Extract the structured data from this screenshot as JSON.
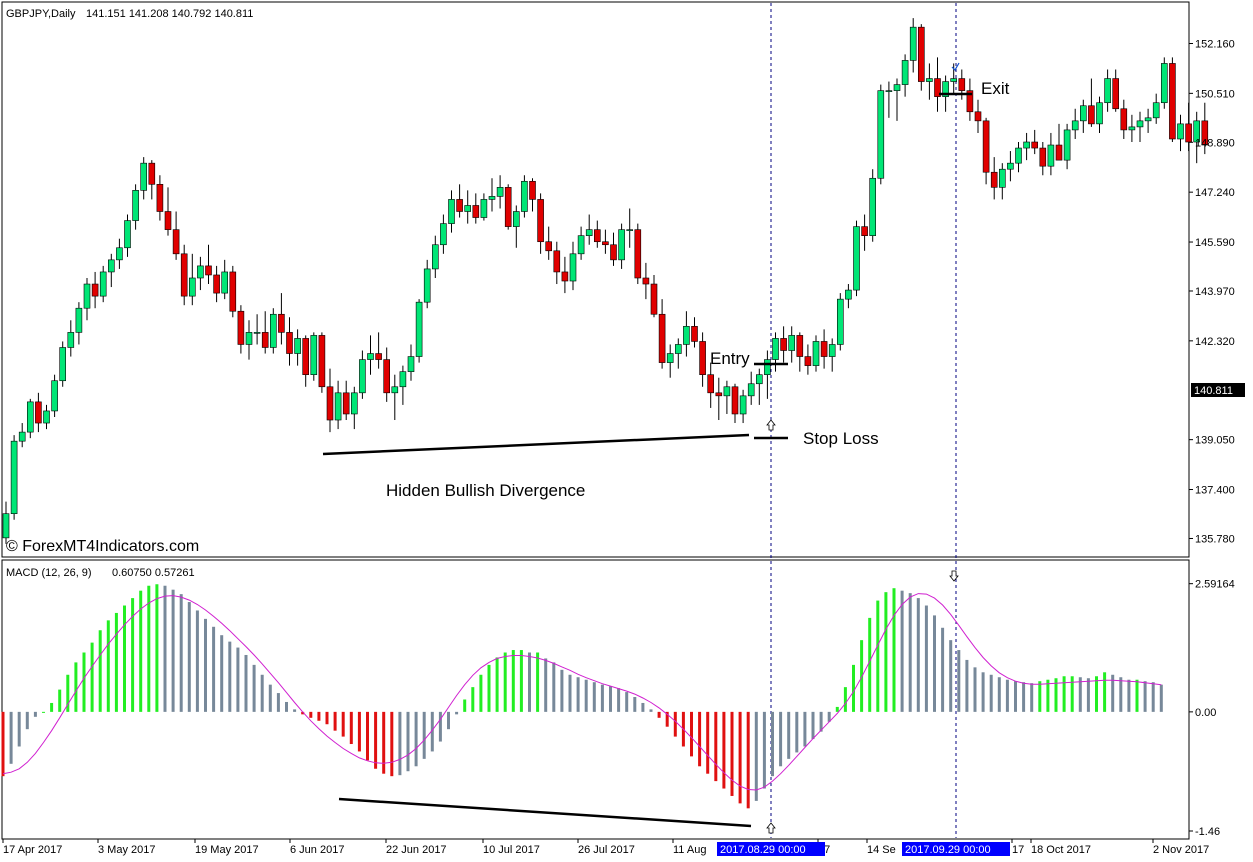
{
  "header": {
    "symbol": "GBPJPY,Daily",
    "ohlc": "141.151 141.208 140.792 140.811",
    "watermark": "© ForexMT4Indicators.com"
  },
  "annotations": {
    "entry": "Entry",
    "stop_loss": "Stop Loss",
    "exit": "Exit",
    "divergence": "Hidden Bullish Divergence"
  },
  "indicator": {
    "title": "MACD (12, 26, 9)",
    "values": "0.60750 0.57261"
  },
  "price_axis": {
    "ticks": [
      "152.160",
      "150.510",
      "148.890",
      "147.240",
      "145.590",
      "143.970",
      "142.320",
      "139.050",
      "137.400",
      "135.780"
    ],
    "current_price": "140.811"
  },
  "macd_axis": {
    "ticks": [
      "2.59164",
      "0.00",
      "-1.46"
    ]
  },
  "time_axis": {
    "labels": [
      "17 Apr 2017",
      "3 May 2017",
      "19 May 2017",
      "6 Jun 2017",
      "22 Jun 2017",
      "10 Jul 2017",
      "26 Jul 2017",
      "11 Aug",
      "17",
      "14 Se",
      "17",
      "18 Oct 2017",
      "2 Nov 2017"
    ],
    "highlight_1": "2017.08.29 00:00",
    "highlight_2": "2017.09.29 00:00"
  },
  "colors": {
    "bull": "#00e676",
    "bear": "#e00000",
    "macd_up": "#22ee22",
    "macd_down_neg": "#e01010",
    "macd_other": "#778899",
    "signal": "#d020d0",
    "highlight": "#0000ff"
  },
  "chart_data": {
    "type": "candlestick",
    "price_ylim": [
      135.2,
      153.5
    ],
    "candles": [
      [
        135.8,
        137.0,
        135.6,
        136.6
      ],
      [
        136.6,
        139.2,
        136.4,
        139.0
      ],
      [
        139.0,
        139.6,
        138.8,
        139.3
      ],
      [
        139.3,
        140.4,
        139.1,
        140.3
      ],
      [
        140.3,
        140.6,
        139.3,
        139.6
      ],
      [
        139.6,
        140.2,
        139.4,
        140.0
      ],
      [
        140.0,
        141.2,
        139.8,
        141.0
      ],
      [
        141.0,
        142.3,
        140.8,
        142.1
      ],
      [
        142.1,
        143.0,
        141.8,
        142.6
      ],
      [
        142.6,
        143.6,
        142.2,
        143.4
      ],
      [
        143.4,
        144.4,
        143.0,
        144.2
      ],
      [
        144.2,
        144.6,
        143.4,
        143.8
      ],
      [
        143.8,
        144.8,
        143.6,
        144.6
      ],
      [
        144.6,
        145.2,
        144.1,
        145.0
      ],
      [
        145.0,
        145.7,
        144.7,
        145.4
      ],
      [
        145.4,
        146.5,
        145.1,
        146.3
      ],
      [
        146.3,
        147.5,
        146.0,
        147.3
      ],
      [
        147.3,
        148.4,
        147.0,
        148.2
      ],
      [
        148.2,
        148.3,
        147.0,
        147.5
      ],
      [
        147.5,
        147.8,
        146.3,
        146.6
      ],
      [
        146.6,
        147.4,
        145.8,
        146.0
      ],
      [
        146.0,
        146.6,
        145.0,
        145.2
      ],
      [
        145.2,
        145.5,
        143.5,
        143.8
      ],
      [
        143.8,
        145.2,
        143.5,
        144.4
      ],
      [
        144.4,
        145.1,
        144.0,
        144.8
      ],
      [
        144.8,
        145.5,
        144.2,
        144.5
      ],
      [
        144.5,
        144.8,
        143.6,
        143.9
      ],
      [
        143.9,
        145.0,
        143.7,
        144.6
      ],
      [
        144.6,
        144.8,
        143.1,
        143.3
      ],
      [
        143.3,
        143.5,
        141.9,
        142.2
      ],
      [
        142.2,
        143.0,
        141.7,
        142.6
      ],
      [
        142.6,
        143.2,
        142.2,
        142.6
      ],
      [
        142.6,
        143.3,
        141.9,
        142.1
      ],
      [
        142.1,
        143.4,
        141.9,
        143.2
      ],
      [
        143.2,
        143.9,
        142.2,
        142.6
      ],
      [
        142.6,
        143.1,
        141.5,
        141.9
      ],
      [
        141.9,
        142.7,
        141.5,
        142.4
      ],
      [
        142.4,
        142.5,
        140.8,
        141.2
      ],
      [
        141.2,
        142.6,
        141.0,
        142.5
      ],
      [
        142.5,
        142.6,
        140.6,
        140.8
      ],
      [
        140.8,
        141.4,
        139.3,
        139.7
      ],
      [
        139.7,
        141.0,
        139.4,
        140.6
      ],
      [
        140.6,
        141.0,
        139.7,
        139.9
      ],
      [
        139.9,
        140.8,
        139.4,
        140.6
      ],
      [
        140.6,
        142.0,
        140.4,
        141.7
      ],
      [
        141.7,
        142.5,
        141.2,
        141.9
      ],
      [
        141.9,
        142.6,
        141.4,
        141.7
      ],
      [
        141.7,
        142.1,
        140.3,
        140.6
      ],
      [
        140.6,
        141.2,
        139.7,
        140.8
      ],
      [
        140.8,
        141.5,
        140.2,
        141.3
      ],
      [
        141.3,
        142.2,
        141.0,
        141.8
      ],
      [
        141.8,
        143.7,
        141.6,
        143.6
      ],
      [
        143.6,
        145.0,
        143.4,
        144.7
      ],
      [
        144.7,
        145.8,
        144.4,
        145.5
      ],
      [
        145.5,
        146.5,
        145.2,
        146.2
      ],
      [
        146.2,
        147.3,
        145.9,
        147.0
      ],
      [
        147.0,
        147.5,
        146.4,
        146.6
      ],
      [
        146.6,
        147.3,
        146.2,
        146.8
      ],
      [
        146.8,
        147.2,
        146.2,
        146.4
      ],
      [
        146.4,
        147.2,
        146.3,
        147.0
      ],
      [
        147.0,
        147.7,
        146.6,
        147.1
      ],
      [
        147.1,
        147.8,
        146.7,
        147.4
      ],
      [
        147.4,
        147.5,
        146.0,
        146.1
      ],
      [
        146.1,
        146.8,
        145.4,
        146.6
      ],
      [
        146.6,
        147.8,
        146.4,
        147.6
      ],
      [
        147.6,
        147.7,
        146.6,
        147.0
      ],
      [
        147.0,
        147.2,
        145.2,
        145.6
      ],
      [
        145.6,
        146.1,
        145.0,
        145.3
      ],
      [
        145.3,
        145.6,
        144.2,
        144.6
      ],
      [
        144.6,
        145.1,
        143.9,
        144.3
      ],
      [
        144.3,
        145.6,
        144.0,
        145.2
      ],
      [
        145.2,
        146.1,
        145.0,
        145.8
      ],
      [
        145.8,
        146.5,
        145.5,
        146.0
      ],
      [
        146.0,
        146.3,
        145.4,
        145.6
      ],
      [
        145.6,
        146.0,
        145.2,
        145.5
      ],
      [
        145.5,
        145.9,
        144.8,
        145.0
      ],
      [
        145.0,
        146.2,
        144.7,
        146.0
      ],
      [
        146.0,
        146.7,
        145.4,
        146.0
      ],
      [
        146.0,
        146.2,
        144.2,
        144.4
      ],
      [
        144.4,
        144.9,
        143.7,
        144.2
      ],
      [
        144.2,
        144.5,
        143.1,
        143.2
      ],
      [
        143.2,
        143.7,
        141.4,
        141.6
      ],
      [
        141.6,
        142.2,
        141.1,
        141.9
      ],
      [
        141.9,
        142.4,
        141.4,
        142.2
      ],
      [
        142.2,
        143.3,
        141.8,
        142.8
      ],
      [
        142.8,
        143.1,
        142.1,
        142.3
      ],
      [
        142.3,
        142.6,
        140.8,
        141.2
      ],
      [
        141.2,
        141.6,
        140.1,
        140.6
      ],
      [
        140.6,
        141.1,
        139.7,
        140.5
      ],
      [
        140.5,
        141.0,
        139.9,
        140.8
      ],
      [
        140.8,
        140.9,
        139.6,
        139.9
      ],
      [
        139.9,
        140.7,
        139.6,
        140.5
      ],
      [
        140.5,
        141.3,
        140.2,
        140.9
      ],
      [
        140.9,
        141.4,
        140.2,
        141.2
      ],
      [
        141.2,
        142.0,
        140.4,
        141.7
      ],
      [
        141.7,
        142.6,
        141.3,
        142.4
      ],
      [
        142.4,
        142.8,
        141.6,
        142.0
      ],
      [
        142.0,
        142.8,
        141.6,
        142.5
      ],
      [
        142.5,
        142.6,
        141.3,
        141.8
      ],
      [
        141.8,
        142.2,
        141.2,
        141.5
      ],
      [
        141.5,
        142.5,
        141.3,
        142.3
      ],
      [
        142.3,
        142.7,
        141.4,
        141.8
      ],
      [
        141.8,
        142.4,
        141.3,
        142.2
      ],
      [
        142.2,
        143.9,
        142.0,
        143.7
      ],
      [
        143.7,
        144.2,
        143.4,
        144.0
      ],
      [
        144.0,
        146.3,
        143.8,
        146.1
      ],
      [
        146.1,
        146.5,
        145.3,
        145.8
      ],
      [
        145.8,
        148.0,
        145.6,
        147.7
      ],
      [
        147.7,
        150.8,
        147.5,
        150.6
      ],
      [
        150.6,
        150.9,
        149.7,
        150.6
      ],
      [
        150.6,
        151.0,
        149.6,
        150.8
      ],
      [
        150.8,
        151.8,
        150.4,
        151.6
      ],
      [
        151.6,
        153.0,
        151.2,
        152.7
      ],
      [
        152.7,
        152.8,
        150.6,
        150.9
      ],
      [
        150.9,
        151.5,
        150.3,
        151.0
      ],
      [
        151.0,
        151.7,
        149.9,
        150.4
      ],
      [
        150.4,
        151.1,
        149.9,
        150.9
      ],
      [
        150.9,
        151.5,
        150.5,
        151.0
      ],
      [
        151.0,
        151.3,
        150.3,
        150.6
      ],
      [
        150.6,
        151.0,
        149.6,
        149.9
      ],
      [
        149.9,
        150.3,
        149.2,
        149.6
      ],
      [
        149.6,
        149.7,
        147.5,
        147.9
      ],
      [
        147.9,
        148.4,
        147.0,
        147.4
      ],
      [
        147.4,
        148.2,
        147.0,
        148.0
      ],
      [
        148.0,
        148.6,
        147.6,
        148.2
      ],
      [
        148.2,
        148.9,
        147.9,
        148.7
      ],
      [
        148.7,
        149.2,
        148.3,
        148.9
      ],
      [
        148.9,
        149.3,
        148.5,
        148.7
      ],
      [
        148.7,
        148.9,
        147.8,
        148.1
      ],
      [
        148.1,
        149.2,
        147.8,
        148.8
      ],
      [
        148.8,
        149.5,
        148.3,
        148.3
      ],
      [
        148.3,
        149.5,
        148.0,
        149.3
      ],
      [
        149.3,
        150.0,
        149.0,
        149.6
      ],
      [
        149.6,
        150.3,
        149.2,
        150.1
      ],
      [
        150.1,
        151.0,
        149.4,
        149.5
      ],
      [
        149.5,
        150.4,
        149.2,
        150.2
      ],
      [
        150.2,
        151.3,
        149.9,
        151.0
      ],
      [
        151.0,
        151.3,
        149.9,
        150.0
      ],
      [
        150.0,
        150.3,
        149.0,
        149.3
      ],
      [
        149.3,
        149.8,
        148.9,
        149.4
      ],
      [
        149.4,
        149.9,
        148.9,
        149.6
      ],
      [
        149.6,
        150.0,
        149.2,
        149.7
      ],
      [
        149.7,
        150.5,
        149.5,
        150.2
      ],
      [
        150.2,
        151.7,
        150.0,
        151.5
      ],
      [
        151.5,
        151.7,
        148.9,
        149.0
      ],
      [
        149.0,
        149.8,
        148.6,
        149.5
      ],
      [
        149.5,
        150.2,
        148.6,
        148.9
      ],
      [
        148.9,
        149.9,
        148.2,
        149.6
      ],
      [
        149.6,
        150.2,
        148.5,
        148.8
      ]
    ],
    "macd_ylim": [
      -2.55,
      3.05
    ],
    "macd_hist": [
      -1.3,
      -1.05,
      -0.7,
      -0.35,
      -0.1,
      0.0,
      0.18,
      0.45,
      0.75,
      1.0,
      1.2,
      1.4,
      1.65,
      1.85,
      2.0,
      2.15,
      2.3,
      2.45,
      2.55,
      2.58,
      2.55,
      2.47,
      2.38,
      2.22,
      2.05,
      1.88,
      1.72,
      1.55,
      1.42,
      1.3,
      1.15,
      0.95,
      0.75,
      0.55,
      0.38,
      0.2,
      0.05,
      -0.05,
      -0.12,
      -0.18,
      -0.25,
      -0.38,
      -0.5,
      -0.65,
      -0.8,
      -0.98,
      -1.15,
      -1.25,
      -1.3,
      -1.28,
      -1.2,
      -1.1,
      -0.95,
      -0.8,
      -0.6,
      -0.35,
      -0.05,
      0.25,
      0.5,
      0.75,
      0.95,
      1.1,
      1.2,
      1.25,
      1.25,
      1.2,
      1.2,
      1.08,
      1.0,
      0.85,
      0.75,
      0.7,
      0.65,
      0.6,
      0.55,
      0.52,
      0.48,
      0.4,
      0.3,
      0.18,
      0.05,
      -0.12,
      -0.3,
      -0.5,
      -0.7,
      -0.9,
      -1.1,
      -1.25,
      -1.4,
      -1.55,
      -1.7,
      -1.85,
      -1.95,
      -1.8,
      -1.55,
      -1.3,
      -1.1,
      -0.95,
      -0.82,
      -0.7,
      -0.55,
      -0.4,
      -0.2,
      0.1,
      0.5,
      0.95,
      1.45,
      1.9,
      2.25,
      2.42,
      2.5,
      2.45,
      2.4,
      2.3,
      2.15,
      1.95,
      1.7,
      1.45,
      1.25,
      1.05,
      0.9,
      0.8,
      0.75,
      0.7,
      0.65,
      0.62,
      0.6,
      0.58,
      0.62,
      0.65,
      0.68,
      0.72,
      0.72,
      0.7,
      0.68,
      0.72,
      0.8,
      0.75,
      0.7,
      0.65,
      0.65,
      0.62,
      0.6,
      0.55
    ],
    "macd_signal": [
      -1.25,
      -1.22,
      -1.15,
      -1.02,
      -0.84,
      -0.62,
      -0.38,
      -0.12,
      0.15,
      0.42,
      0.68,
      0.92,
      1.15,
      1.37,
      1.57,
      1.76,
      1.93,
      2.08,
      2.2,
      2.29,
      2.34,
      2.35,
      2.32,
      2.26,
      2.17,
      2.06,
      1.93,
      1.79,
      1.64,
      1.48,
      1.32,
      1.15,
      0.97,
      0.78,
      0.59,
      0.39,
      0.19,
      0.0,
      -0.18,
      -0.34,
      -0.49,
      -0.62,
      -0.74,
      -0.84,
      -0.93,
      -0.99,
      -1.03,
      -1.04,
      -1.02,
      -0.96,
      -0.87,
      -0.74,
      -0.57,
      -0.37,
      -0.15,
      0.09,
      0.33,
      0.55,
      0.74,
      0.89,
      1.0,
      1.08,
      1.12,
      1.14,
      1.14,
      1.12,
      1.09,
      1.04,
      0.98,
      0.91,
      0.84,
      0.76,
      0.69,
      0.63,
      0.57,
      0.52,
      0.47,
      0.42,
      0.36,
      0.28,
      0.19,
      0.08,
      -0.05,
      -0.19,
      -0.35,
      -0.52,
      -0.7,
      -0.88,
      -1.06,
      -1.23,
      -1.38,
      -1.5,
      -1.57,
      -1.58,
      -1.52,
      -1.4,
      -1.25,
      -1.08,
      -0.9,
      -0.72,
      -0.54,
      -0.37,
      -0.2,
      -0.03,
      0.17,
      0.41,
      0.7,
      1.02,
      1.35,
      1.67,
      1.95,
      2.17,
      2.32,
      2.39,
      2.38,
      2.3,
      2.16,
      1.97,
      1.75,
      1.52,
      1.3,
      1.1,
      0.93,
      0.79,
      0.69,
      0.62,
      0.58,
      0.56,
      0.56,
      0.57,
      0.58,
      0.59,
      0.6,
      0.61,
      0.62,
      0.63,
      0.64,
      0.64,
      0.63,
      0.62,
      0.61,
      0.59,
      0.57,
      0.55
    ]
  }
}
